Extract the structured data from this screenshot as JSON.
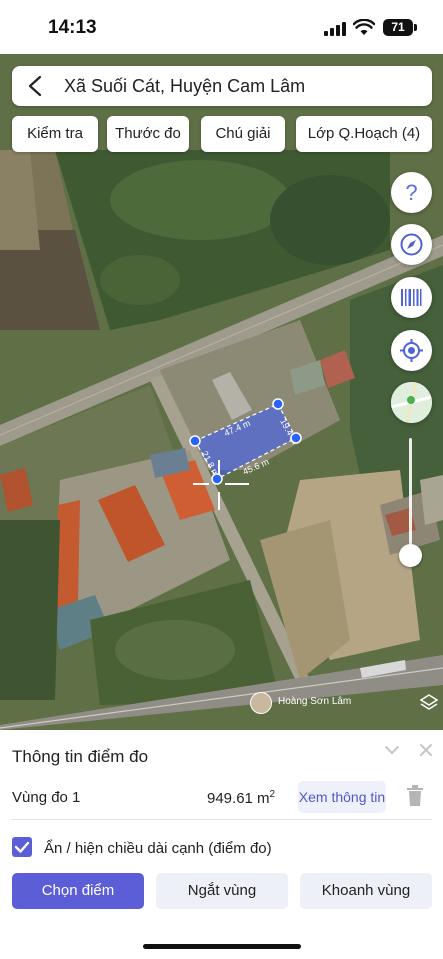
{
  "status_bar": {
    "time": "14:13",
    "battery": "71",
    "icons": [
      "signal-icon",
      "wifi-icon",
      "battery-icon"
    ]
  },
  "search": {
    "title": "Xã Suối Cát, Huyện Cam Lâm"
  },
  "toolbar": {
    "buttons": [
      {
        "label": "Kiểm tra"
      },
      {
        "label": "Thước đo"
      },
      {
        "label": "Chú giải"
      },
      {
        "label": "Lớp Q.Hoạch (4)"
      }
    ]
  },
  "side_controls": [
    "help-icon",
    "compass-icon",
    "barcode-icon",
    "locate-icon",
    "map-layer-thumbnail"
  ],
  "measurement": {
    "edges": [
      {
        "label": "47.4 m"
      },
      {
        "label": "19.4 m"
      },
      {
        "label": "45.6 m"
      },
      {
        "label": "21.8 m"
      }
    ],
    "fill_color": "#3b5bff",
    "point_color": "#2962ff"
  },
  "attribution": {
    "name": "Hoàng Sơn Lâm"
  },
  "panel": {
    "title": "Thông tin điểm đo",
    "row": {
      "label": "Vùng đo 1",
      "area_value": "949.61 m",
      "area_unit_exp": "2",
      "info_button": "Xem thông tin"
    },
    "toggle": {
      "checked": true,
      "label": "Ẩn / hiện chiều dài cạnh (điểm đo)"
    },
    "actions": [
      {
        "label": "Chọn điểm"
      },
      {
        "label": "Ngắt vùng"
      },
      {
        "label": "Khoanh vùng"
      }
    ],
    "accent_color": "#5b5ed7"
  }
}
